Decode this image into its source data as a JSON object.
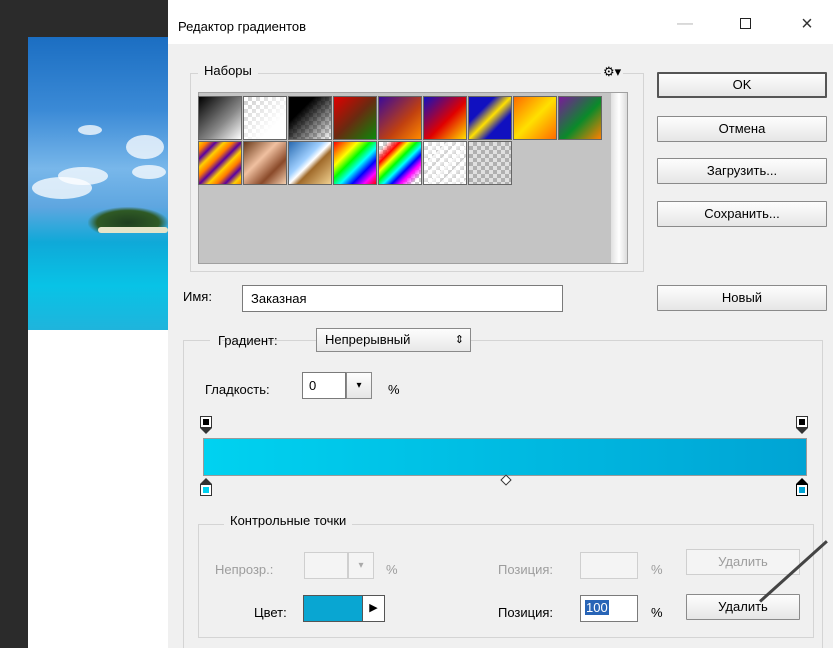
{
  "window": {
    "title": "Редактор градиентов",
    "minimize": "—",
    "close": "×"
  },
  "presets": {
    "legend": "Наборы",
    "menu_icon": "⚙▾",
    "swatches": [
      "black-white",
      "transparent-white",
      "black-transparent",
      "red-green",
      "violet-orange",
      "blue-red-yellow",
      "blue-yellow-blue",
      "orange-yellow-orange",
      "violet-green-orange",
      "copper-stripes",
      "copper",
      "chrome",
      "spectrum",
      "rainbow-transparent",
      "transparent-stripes",
      "transparent-checker"
    ]
  },
  "buttons": {
    "ok": "OK",
    "cancel": "Отмена",
    "load": "Загрузить...",
    "save": "Сохранить...",
    "new": "Новый"
  },
  "name": {
    "label": "Имя:",
    "value": "Заказная"
  },
  "gradient": {
    "type_label": "Градиент:",
    "type_value": "Непрерывный",
    "type_arrow": "⇕",
    "smooth_label": "Гладкость:",
    "smooth_value": "0",
    "smooth_unit": "%",
    "start_color": "#00d2f0",
    "end_color": "#00a4d4"
  },
  "stops": {
    "legend": "Контрольные точки",
    "opacity_label": "Непрозр.:",
    "opacity_value": "",
    "opacity_unit": "%",
    "opacity_position_label": "Позиция:",
    "opacity_position_unit": "%",
    "opacity_delete": "Удалить",
    "color_label": "Цвет:",
    "color_value": "#09a6d2",
    "color_position_label": "Позиция:",
    "color_position_value": "100",
    "color_position_unit": "%",
    "color_delete": "Удалить"
  }
}
